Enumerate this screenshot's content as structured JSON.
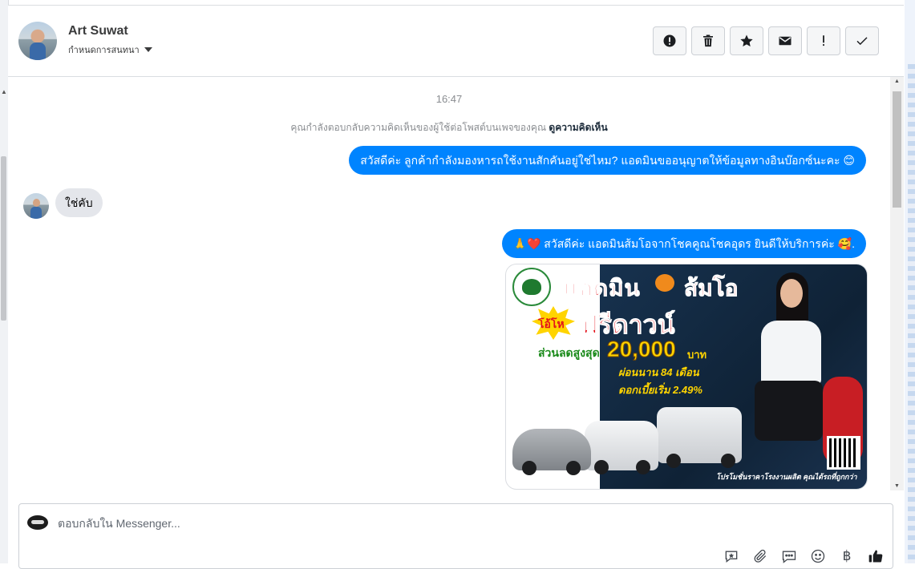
{
  "contact": {
    "name": "Art Suwat",
    "manage_label": "กำหนดการสนทนา"
  },
  "toolbar": {
    "buttons": [
      {
        "icon": "alert-circle-icon",
        "glyph": "!"
      },
      {
        "icon": "trash-icon",
        "glyph": "trash"
      },
      {
        "icon": "star-icon",
        "glyph": "star"
      },
      {
        "icon": "envelope-icon",
        "glyph": "mail"
      },
      {
        "icon": "exclamation-icon",
        "glyph": "!"
      },
      {
        "icon": "check-icon",
        "glyph": "check"
      }
    ]
  },
  "conversation": {
    "timestamp": "16:47",
    "notice_text": "คุณกำลังตอบกลับความคิดเห็นของผู้ใช้ต่อโพสต์บนเพจของคุณ",
    "notice_link": "ดูความคิดเห็น",
    "messages": [
      {
        "direction": "outgoing",
        "text": "สวัสดีค่ะ ลูกค้ากำลังมองหารถใช้งานสักคันอยู่ใช่ไหม? แอดมินขออนุญาตให้ข้อมูลทางอินบ๊อกซ์นะคะ",
        "emoji": "😊"
      },
      {
        "direction": "incoming",
        "text": "ใช่คับ"
      },
      {
        "direction": "outgoing",
        "prefix_emoji": "🙏❤️",
        "text": "สวัสดีค่ะ แอดมินส้มโอจากโชคคูณโชคอุดร ยินดีให้บริการค่ะ",
        "emoji": "🥰."
      }
    ],
    "promo_image": {
      "headline_admin": "แอดมิน",
      "headline_name": "ส้มโอ",
      "burst": "โอ้โห",
      "free_down": "ฟรีดาวน์",
      "discount_label": "ส่วนลดสูงสุด",
      "discount_amount": "20,000",
      "currency": "บาท",
      "installment": "ผ่อนนาน 84 เดือน",
      "interest": "ดอกเบี้ยเริ่ม 2.49%",
      "footer": "โปรโมชั่นราคาโรงงานผลิต คุณได้รถที่ถูกกว่า"
    }
  },
  "composer": {
    "placeholder": "ตอบกลับใน Messenger...",
    "currency_symbol": "฿",
    "icons": [
      "saved-reply-icon",
      "attachment-icon",
      "chat-bubble-icon",
      "emoji-icon",
      "baht-icon",
      "thumbs-up-icon"
    ]
  }
}
